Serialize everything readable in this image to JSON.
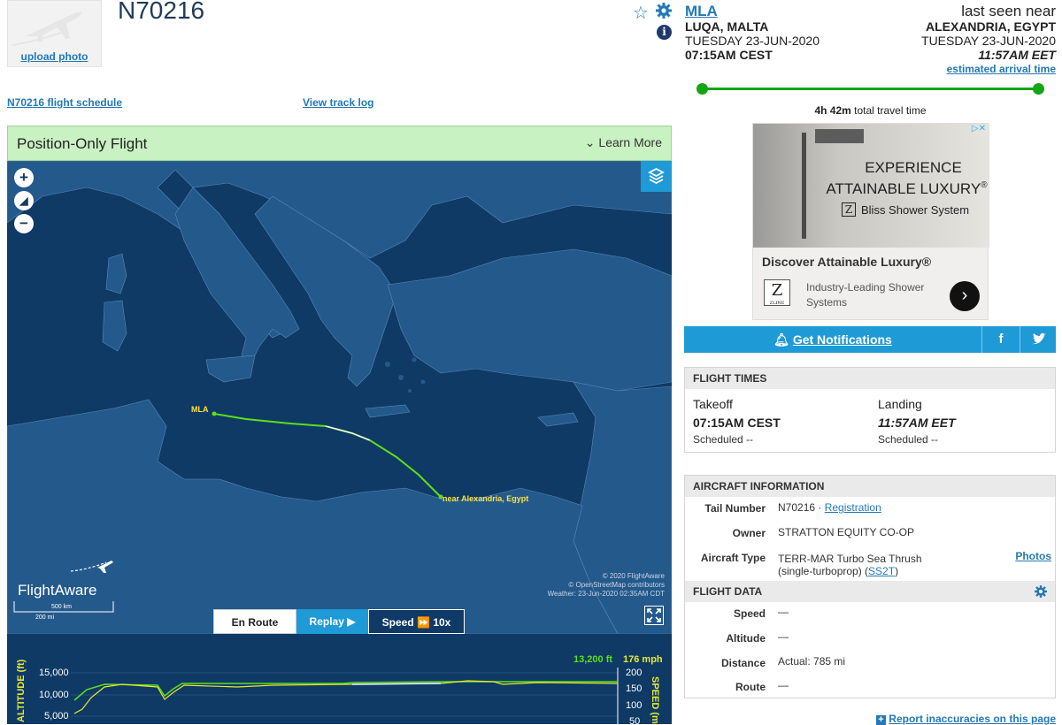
{
  "header": {
    "tail": "N70216",
    "upload_photo": "upload photo",
    "schedule_link": "N70216 flight schedule",
    "track_log_link": "View track log"
  },
  "origin": {
    "code": "MLA",
    "city": "LUQA, MALTA",
    "date": "TUESDAY 23-JUN-2020",
    "time": "07:15AM CEST"
  },
  "destination": {
    "status": "last seen near",
    "city": "ALEXANDRIA, EGYPT",
    "date": "TUESDAY 23-JUN-2020",
    "time": "11:57AM EET",
    "note": "estimated arrival time"
  },
  "travel": {
    "duration": "4h 42m",
    "suffix": "total travel time",
    "progress": 1.0
  },
  "flight_type": {
    "label": "Position-Only Flight",
    "learn_more": "Learn More"
  },
  "map": {
    "origin_label": "MLA",
    "dest_label": "near Alexandria, Egypt",
    "brand": "FlightAware",
    "copyright1": "© 2020 FlightAware",
    "copyright2": "© OpenStreetMap contributors",
    "weather": "Weather: 23-Jun-2020 02:35AM CDT",
    "scale_km": "500 km",
    "scale_mi": "200 mi",
    "zoom_in": "+",
    "zoom_out": "−"
  },
  "controls": {
    "en_route": "En Route",
    "replay": "Replay",
    "speed_label": "Speed",
    "speed_value": "10x"
  },
  "altchart": {
    "alt_readout": "13,200 ft",
    "speed_readout": "176 mph",
    "alt_axis": "ALTITUDE (ft)",
    "speed_axis": "SPEED (mph)",
    "alt_ticks": [
      "15,000",
      "10,000",
      "5,000"
    ],
    "speed_ticks": [
      "200",
      "150",
      "100",
      "50"
    ]
  },
  "ad": {
    "headline1": "EXPERIENCE",
    "headline2": "ATTAINABLE LUXURY",
    "registered": "®",
    "logo_text": "Z",
    "product": "Bliss Shower System",
    "brand_sub": "ZLINE",
    "title": "Discover Attainable Luxury®",
    "desc": "Industry-Leading Shower Systems",
    "adchoices": "▷✕"
  },
  "notify": {
    "label": "Get Notifications",
    "fb": "f"
  },
  "flight_times": {
    "title": "FLIGHT TIMES",
    "takeoff_label": "Takeoff",
    "takeoff_time": "07:15AM CEST",
    "takeoff_sched": "Scheduled --",
    "landing_label": "Landing",
    "landing_time": "11:57AM EET",
    "landing_sched": "Scheduled --"
  },
  "aircraft": {
    "title": "AIRCRAFT INFORMATION",
    "tail_label": "Tail Number",
    "tail_value": "N70216 ·",
    "registration": "Registration",
    "owner_label": "Owner",
    "owner_value": "STRATTON EQUITY CO-OP",
    "type_label": "Aircraft Type",
    "type_value": "TERR-MAR Turbo Sea Thrush (single-turboprop) (",
    "type_code": "SS2T",
    "type_close": ")",
    "photos": "Photos"
  },
  "flight_data": {
    "title": "FLIGHT DATA",
    "speed_label": "Speed",
    "speed_value": "—",
    "altitude_label": "Altitude",
    "altitude_value": "—",
    "distance_label": "Distance",
    "distance_value": "Actual: 785 mi",
    "route_label": "Route",
    "route_value": "—"
  },
  "footer": {
    "report": "Report inaccuracies on this page"
  },
  "colors": {
    "link": "#2479b6",
    "sea": "#0f3a66",
    "land": "#24598c",
    "track": "#5ce018",
    "banner": "#c8f2c1",
    "notify": "#1e9ad6"
  }
}
